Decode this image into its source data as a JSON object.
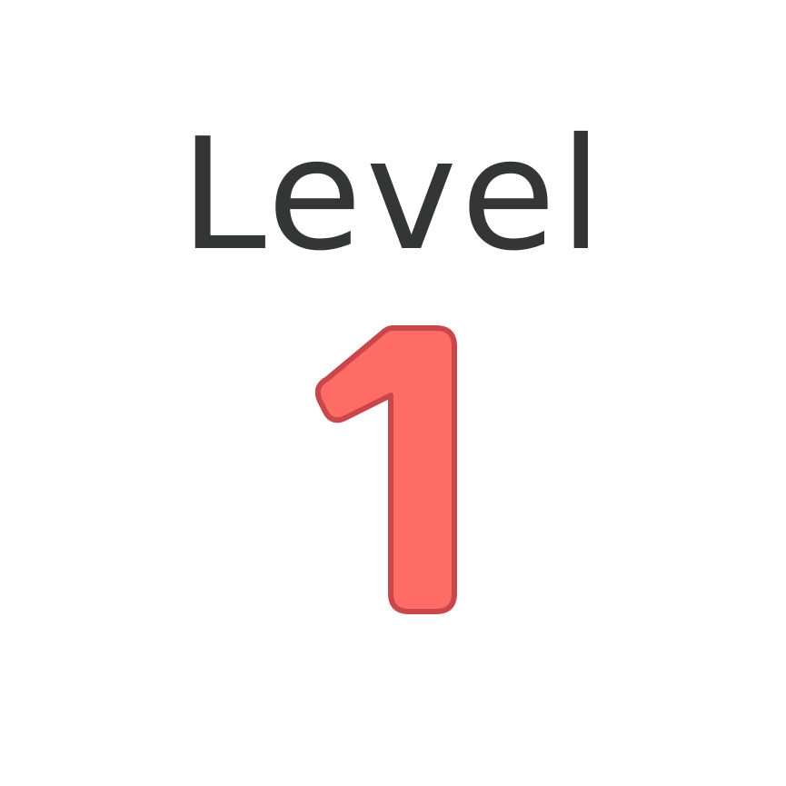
{
  "level": {
    "label": "Level",
    "number": "1"
  },
  "colors": {
    "background": "#ffffff",
    "label_text": "#333634",
    "number_fill": "#ff6b65",
    "number_outline": "#c9474a"
  }
}
